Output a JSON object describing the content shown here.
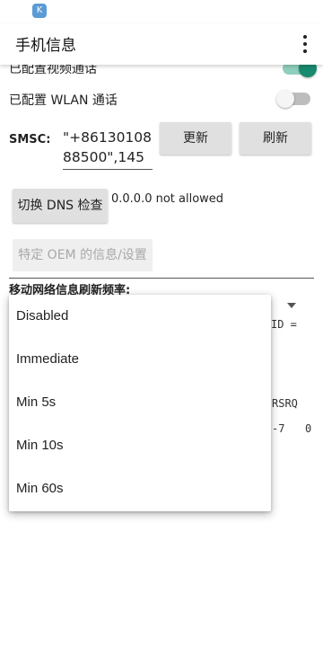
{
  "status_bar": {
    "app_icon_glyph": "K"
  },
  "app_bar": {
    "title": "手机信息",
    "overflow_icon": "more-vert-icon"
  },
  "settings": {
    "video_calling": {
      "label": "已配置视频通话",
      "enabled": true
    },
    "wlan_calling": {
      "label": "已配置 WLAN 通话",
      "enabled": false
    }
  },
  "smsc": {
    "label": "SMSC:",
    "value": "\"+8613010888500\",145",
    "update_label": "更新",
    "refresh_label": "刷新"
  },
  "dns": {
    "toggle_label": "切换 DNS 检查",
    "status": "0.0.0.0 not allowed"
  },
  "oem": {
    "label": "特定 OEM 的信息/设置"
  },
  "refresh_rate": {
    "label": "移动网络信息刷新频率:",
    "options": [
      "Disabled",
      "Immediate",
      "Min 5s",
      "Min 10s",
      "Min 60s"
    ]
  },
  "background_fragments": {
    "id_text": "ID =",
    "rsrq_text": "RSRQ",
    "value_a": "-7",
    "value_b": "0"
  },
  "colors": {
    "accent": "#188a6e",
    "switch_track_on": "#8fcfbd",
    "button_bg": "#e0e0e0"
  }
}
